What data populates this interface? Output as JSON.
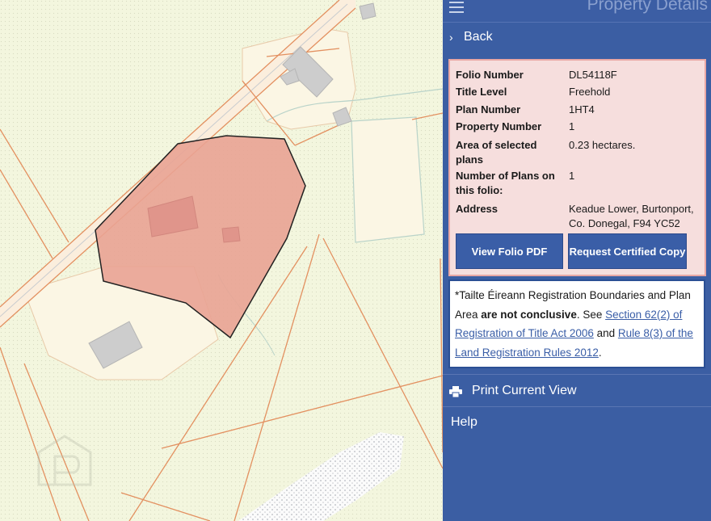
{
  "panel": {
    "title": "Property Details",
    "back_label": "Back",
    "fields": [
      {
        "label": "Folio Number",
        "value": "DL54118F"
      },
      {
        "label": "Title Level",
        "value": "Freehold"
      },
      {
        "label": "Plan Number",
        "value": "1HT4"
      },
      {
        "label": "Property Number",
        "value": "1"
      },
      {
        "label": "Area of selected plans",
        "value": "0.23 hectares."
      },
      {
        "label": "Number of Plans on this folio:",
        "value": "1"
      },
      {
        "label": "Address",
        "value": "Keadue Lower, Burtonport, Co. Donegal, F94 YC52"
      }
    ],
    "buttons": {
      "view_pdf": "View Folio PDF",
      "request_copy": "Request Certified Copy"
    },
    "disclaimer": {
      "prefix": "*Tailte Éireann Registration Boundaries and Plan Area ",
      "bold": "are not conclusive",
      "mid1": ". See ",
      "link1": "Section 62(2) of Registration of Title Act 2006",
      "mid2": " and ",
      "link2": "Rule 8(3) of the Land Registration Rules 2012",
      "suffix": "."
    },
    "print_label": "Print Current View",
    "help_label": "Help"
  },
  "colors": {
    "panel_bg": "#3b5ea3",
    "details_bg": "#f6dedd",
    "details_border": "#e9a7a4",
    "parcel_fill": "#e9a393",
    "map_bg": "#f3f6de",
    "boundary": "#e39060",
    "button_bg": "#3a5ea7"
  },
  "icons": {
    "menu": "hamburger-icon",
    "back": "chevron-right-icon",
    "print": "printer-icon"
  }
}
